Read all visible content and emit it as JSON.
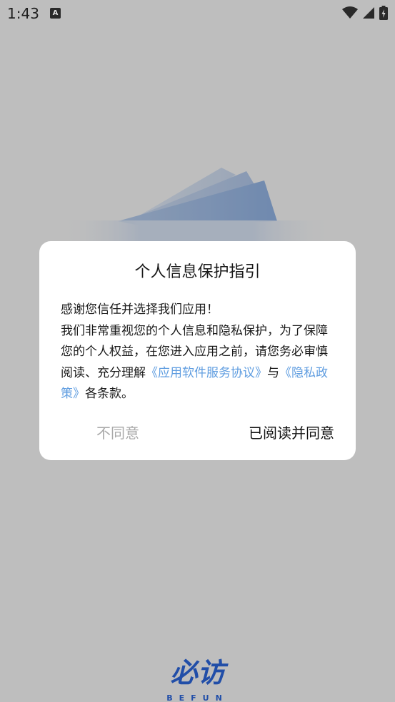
{
  "status_bar": {
    "time": "1:43",
    "notification_badge": "A"
  },
  "icons": {
    "wifi": "wifi-icon",
    "signal": "cellular-signal-icon",
    "battery": "battery-charging-icon"
  },
  "dialog": {
    "title": "个人信息保护指引",
    "body": {
      "line1": "感谢您信任并选择我们应用！",
      "line2_prefix": "我们非常重视您的个人信息和隐私保护，为了保障您的个人权益，在您进入应用之前，请您务必审慎阅读、充分理解",
      "service_agreement_link": "《应用软件服务协议》",
      "conjunction": "与",
      "privacy_policy_link": "《隐私政策》",
      "suffix": "各条款。"
    },
    "disagree_label": "不同意",
    "agree_label": "已阅读并同意"
  },
  "logo": {
    "cn": "必访",
    "en": "BEFUN"
  },
  "colors": {
    "brand_blue": "#2b64d8",
    "link_blue": "#5f9de0",
    "disabled_gray": "#a9a9a9"
  }
}
